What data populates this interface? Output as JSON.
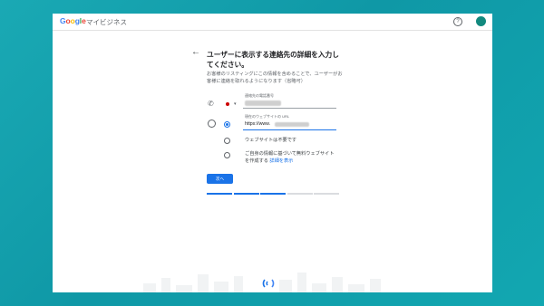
{
  "header": {
    "logo_letters": [
      {
        "ch": "G",
        "color": "#4285F4"
      },
      {
        "ch": "o",
        "color": "#EA4335"
      },
      {
        "ch": "o",
        "color": "#FBBC05"
      },
      {
        "ch": "g",
        "color": "#4285F4"
      },
      {
        "ch": "l",
        "color": "#34A853"
      },
      {
        "ch": "e",
        "color": "#EA4335"
      }
    ],
    "product_name": "マイビジネス",
    "help_icon": "help-circle-icon",
    "avatar_color": "#12897e"
  },
  "page": {
    "back_icon": "arrow-back-icon",
    "title": "ユーザーに表示する連絡先の詳細を入力してください。",
    "subtitle": "お客様のリスティングにこの情報を含めることで、ユーザーがお客様に連絡を取れるようになります（省略可）"
  },
  "phone": {
    "icon": "phone-icon",
    "label": "連絡先の電話番号",
    "flag_icon": "japan-flag-icon",
    "value": "●●● ●●● ●●●●"
  },
  "website": {
    "icon": "globe-icon",
    "url_label": "現在のウェブサイトの URL",
    "url_prefix": "https://www.",
    "url_rest": "●●●●●●●●●●●●●",
    "options": [
      {
        "text": "ウェブサイトは不要です",
        "link": ""
      },
      {
        "text": "ご自身の情報に基づいて無料ウェブサイトを作成する",
        "link": "詳細を表示"
      }
    ]
  },
  "actions": {
    "next_label": "次へ"
  },
  "progress": {
    "completed": 3,
    "total": 5,
    "active_color": "#1a73e8",
    "inactive_color": "#dadce0"
  }
}
